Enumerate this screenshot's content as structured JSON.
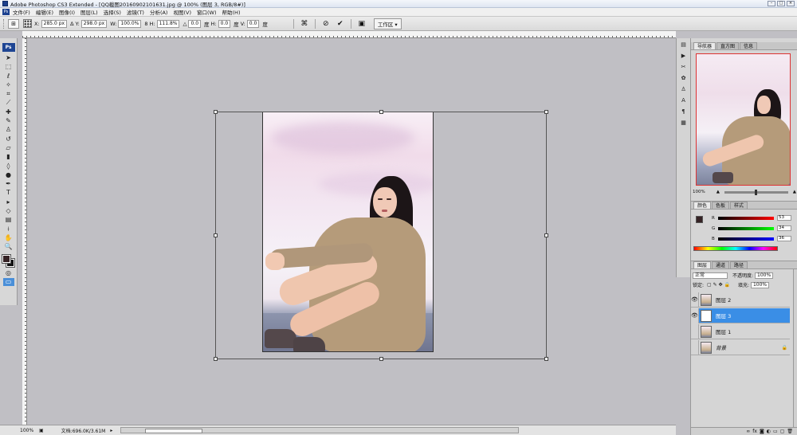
{
  "window": {
    "title": "Adobe Photoshop CS3 Extended - [QQ截图20160902101631.jpg @ 100% (图层 3, RGB/8#)]"
  },
  "menu": [
    "文件(F)",
    "编辑(E)",
    "图像(I)",
    "图层(L)",
    "选择(S)",
    "滤镜(T)",
    "分析(A)",
    "视图(V)",
    "窗口(W)",
    "帮助(H)"
  ],
  "options": {
    "x_label": "X:",
    "x_value": "285.0 px",
    "y_label": "Y:",
    "y_value": "298.0 px",
    "w_label": "W:",
    "w_value": "100.0%",
    "h_label": "H:",
    "h_value": "111.8%",
    "angle_value": "0.0",
    "angle_unit": "度",
    "hskew_label": "H:",
    "hskew_value": "0.0",
    "hskew_unit": "度",
    "vskew_label": "V:",
    "vskew_value": "0.0",
    "vskew_unit": "度",
    "workspace": "工作区 ▾"
  },
  "toolbox": {
    "logo": "Ps"
  },
  "status": {
    "zoom": "100%",
    "doc": "文档:696.0K/3.61M",
    "arrow": "▸"
  },
  "panels": {
    "navigator_tabs": [
      "导航器",
      "直方图",
      "信息"
    ],
    "navigator_zoom": "100%",
    "color_tabs": [
      "颜色",
      "色板",
      "样式"
    ],
    "color": {
      "r_label": "R",
      "r_value": "53",
      "g_label": "G",
      "g_value": "34",
      "b_label": "B",
      "b_value": "36"
    },
    "layers_tabs": [
      "图层",
      "通道",
      "路径"
    ],
    "blend_mode": "正常",
    "opacity_label": "不透明度:",
    "opacity_value": "100%",
    "lock_label": "锁定:",
    "fill_label": "填充:",
    "fill_value": "100%",
    "layers": [
      {
        "name": "图层 2",
        "visible": true,
        "selected": false
      },
      {
        "name": "图层 3",
        "visible": true,
        "selected": true
      },
      {
        "name": "图层 1",
        "visible": false,
        "selected": false
      },
      {
        "name": "背景",
        "visible": false,
        "selected": false,
        "locked": true
      }
    ]
  },
  "colors": {
    "foreground": "#352224",
    "background": "#111111",
    "selected_layer": "#3a8ee6"
  }
}
